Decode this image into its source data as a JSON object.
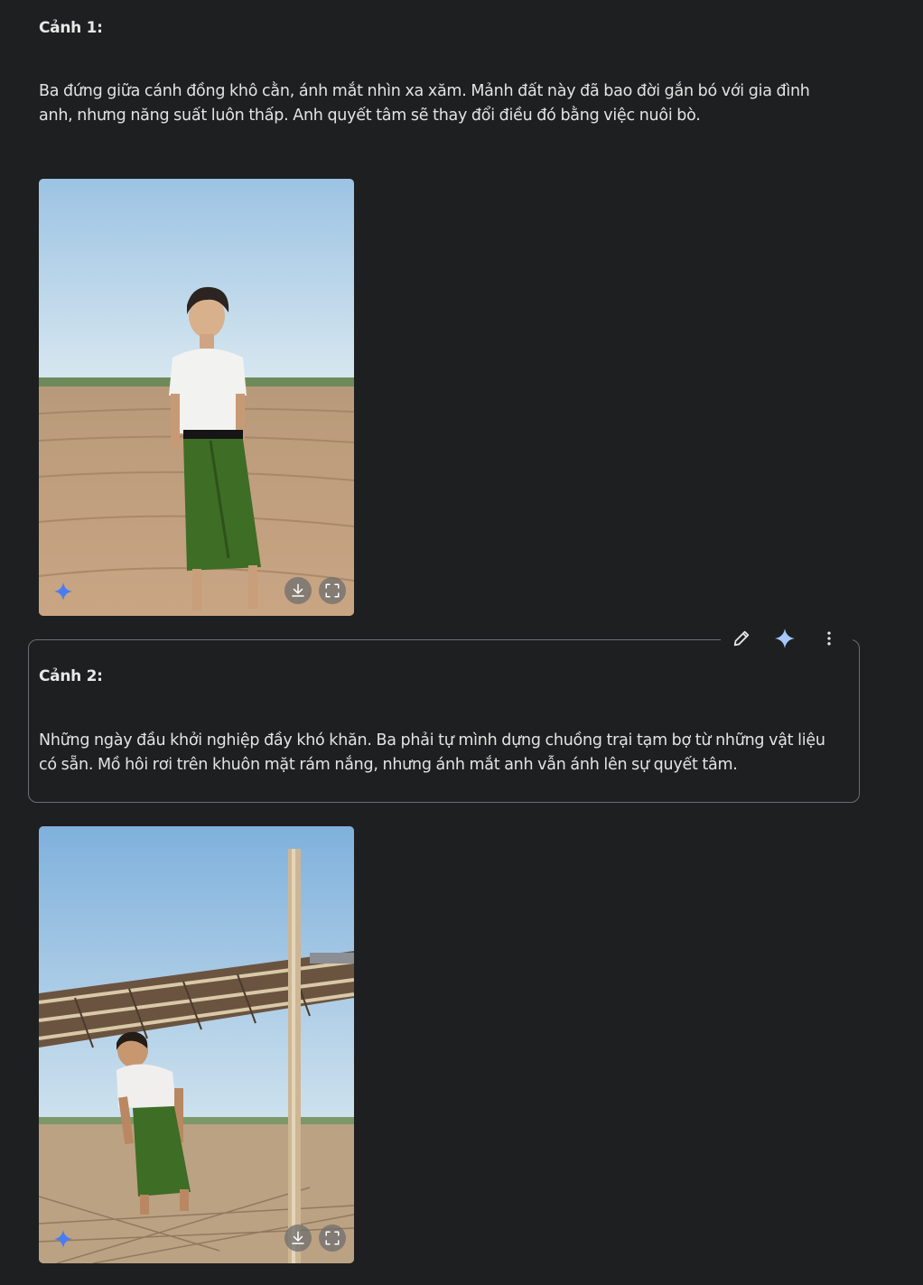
{
  "scenes": [
    {
      "heading": "Cảnh 1:",
      "line1": "Ba đứng giữa cánh đồng khô cằn, ánh mắt nhìn xa xăm. Mảnh đất này đã bao đời gắn bó với gia đình",
      "line2": "anh, nhưng năng suất luôn thấp. Anh quyết tâm sẽ thay đổi điều đó bằng việc nuôi bò."
    },
    {
      "heading": "Cảnh 2:",
      "line1": "Những ngày đầu khởi nghiệp đầy khó khăn. Ba phải tự mình dựng chuồng trại tạm bợ từ những vật liệu",
      "line2": "có sẵn. Mồ hôi rơi trên khuôn mặt rám nắng, nhưng ánh mắt anh vẫn ánh lên sự quyết tâm."
    }
  ],
  "toolbar": {
    "edit_icon": "pencil-icon",
    "sparkle_icon": "sparkle-icon",
    "more_icon": "more-vertical-icon"
  },
  "image_actions": {
    "download_icon": "download-icon",
    "fullscreen_icon": "fullscreen-icon",
    "badge_icon": "sparkle-icon"
  },
  "colors": {
    "background": "#1e1f20",
    "text": "#e3e3e3",
    "sparkle_blue": "#4a7cf0",
    "toolbar_sparkle": "#a8c7fa"
  }
}
